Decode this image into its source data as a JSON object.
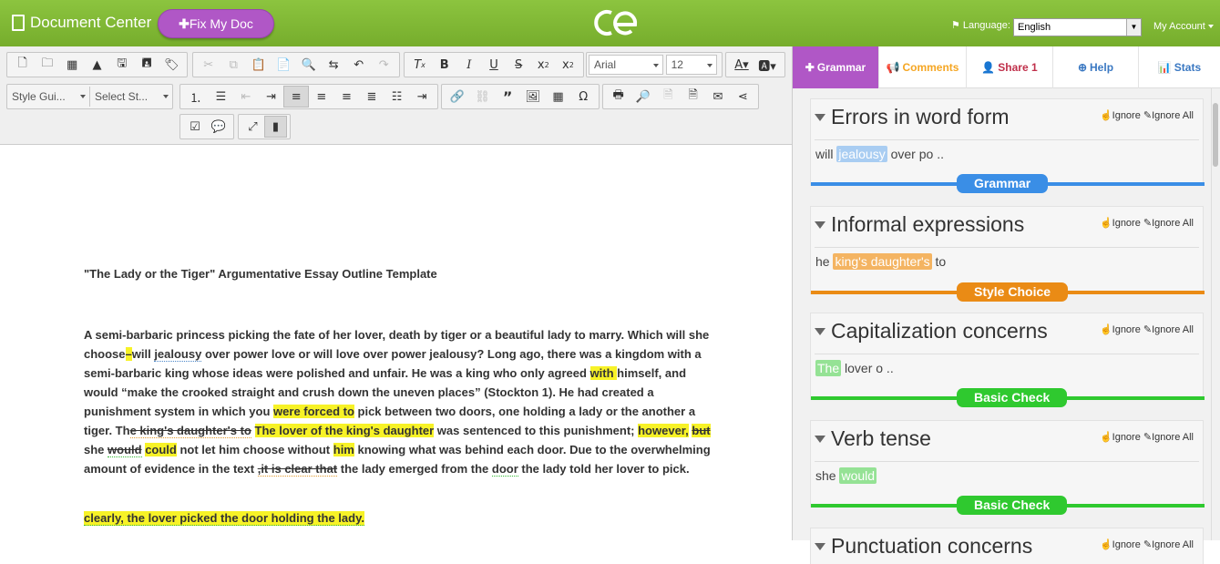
{
  "header": {
    "doc_center": "Document Center",
    "fix_button": "Fix My Doc",
    "logo_text": "ce",
    "language_label": "Language:",
    "language_value": "English",
    "my_account": "My Account"
  },
  "toolbar": {
    "style_guide": "Style Gui...",
    "select_style": "Select St...",
    "font_family": "Arial",
    "font_size": "12"
  },
  "document": {
    "title": "\"The Lady or the Tiger\" Argumentative Essay Outline Template",
    "p1": {
      "s1": "A semi-barbaric princess picking the fate of her lover, death by tiger or a beautiful lady to marry. Which will she choose",
      "s1_hl": "–",
      "s2": "will ",
      "s2_wavy": "jealousy",
      "s3": " over power love or will love over power jealousy? Long ago, there was a kingdom with a semi-barbaric king whose ideas were polished and unfair. He was a king who only agreed ",
      "s3_hl": "with ",
      "s4": "himself, and would “make the crooked straight and crush down the uneven places” (Stockton 1). He had created a punishment system in which you ",
      "s4_hl": "were forced to",
      "s5": " pick between two doors, one holding  a lady or the another a tiger. Th",
      "s5_strike": "e king's daughter's  to",
      "s6": " ",
      "s6_hl": "The lover of the king's daughter",
      "s7": " was sentenced to this punishment; ",
      "s7_hl": "however,",
      "s8": " ",
      "s8_strike": "but ",
      "s9": "she ",
      "s9_strike": "would",
      "s10": " ",
      "s10_hl": "could",
      "s11": " not let him choose without ",
      "s11_hl": "him",
      "s12": " knowing what was behind each door. Due to the overwhelming amount of evidence in the text ",
      "s12_strike": ",it is clear that",
      "s13": " the lady emerged from the ",
      "s13_wavy": "door",
      "s14": " the lady told her lover to pick."
    },
    "p2": "clearly, the lover picked the door holding the lady."
  },
  "panel": {
    "tabs": {
      "grammar": "Grammar",
      "comments": "Comments",
      "share": "Share 1",
      "help": "Help",
      "stats": "Stats"
    },
    "ignore": "Ignore",
    "ignore_all": "Ignore All",
    "cards": [
      {
        "title": "Errors in word form",
        "pre": "will",
        "flag": "jealousy",
        "post": "over po ..",
        "label": "Grammar",
        "color": "#3a8ee6",
        "flag_bg": "#a9cdf2"
      },
      {
        "title": "Informal expressions",
        "pre": "he",
        "flag": "king's daughter's",
        "post": " to",
        "label": "Style Choice",
        "color": "#ea8b15",
        "flag_bg": "#f4b462"
      },
      {
        "title": "Capitalization concerns",
        "pre": "",
        "flag": "The",
        "post": "lover o ..",
        "label": "Basic Check",
        "color": "#2fc92f",
        "flag_bg": "#95e295"
      },
      {
        "title": "Verb tense",
        "pre": "she",
        "flag": "would",
        "post": "",
        "label": "Basic Check",
        "color": "#2fc92f",
        "flag_bg": "#95e295"
      },
      {
        "title": "Punctuation concerns",
        "pre": "",
        "flag": "",
        "post": "",
        "label": "",
        "color": "#2fc92f",
        "flag_bg": "#95e295"
      }
    ]
  }
}
